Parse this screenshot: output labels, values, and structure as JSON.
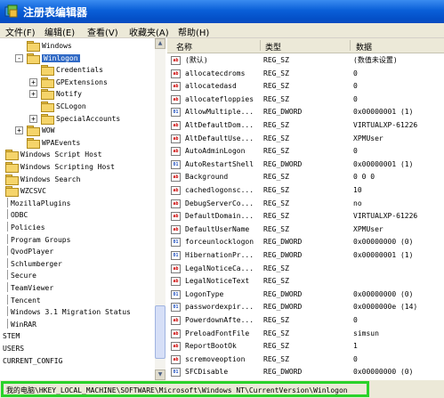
{
  "window": {
    "title": "注册表编辑器"
  },
  "menu": [
    "文件(F)",
    "编辑(E)",
    "查看(V)",
    "收藏夹(A)",
    "帮助(H)"
  ],
  "tree": [
    {
      "label": "Windows",
      "level": 3,
      "icon": "folder",
      "expander": ""
    },
    {
      "label": "Winlogon",
      "level": 3,
      "icon": "folder-open",
      "expander": "-",
      "selected": true
    },
    {
      "label": "Credentials",
      "level": 4,
      "icon": "folder",
      "expander": ""
    },
    {
      "label": "GPExtensions",
      "level": 4,
      "icon": "folder",
      "expander": "+"
    },
    {
      "label": "Notify",
      "level": 4,
      "icon": "folder",
      "expander": "+"
    },
    {
      "label": "SCLogon",
      "level": 4,
      "icon": "folder",
      "expander": ""
    },
    {
      "label": "SpecialAccounts",
      "level": 4,
      "icon": "folder",
      "expander": "+"
    },
    {
      "label": "WOW",
      "level": 3,
      "icon": "folder",
      "expander": "+"
    },
    {
      "label": "WPAEvents",
      "level": 3,
      "icon": "folder",
      "expander": ""
    },
    {
      "label": "Windows Script Host",
      "level": 1,
      "icon": "folder",
      "expander": ""
    },
    {
      "label": "Windows Scripting Host",
      "level": 1,
      "icon": "folder",
      "expander": ""
    },
    {
      "label": "Windows Search",
      "level": 1,
      "icon": "folder",
      "expander": ""
    },
    {
      "label": "WZCSVC",
      "level": 1,
      "icon": "folder",
      "expander": ""
    },
    {
      "label": "MozillaPlugins",
      "level": 0,
      "icon": "",
      "expander": ""
    },
    {
      "label": "ODBC",
      "level": 0,
      "icon": "",
      "expander": ""
    },
    {
      "label": "Policies",
      "level": 0,
      "icon": "",
      "expander": ""
    },
    {
      "label": "Program Groups",
      "level": 0,
      "icon": "",
      "expander": ""
    },
    {
      "label": "QvodPlayer",
      "level": 0,
      "icon": "",
      "expander": ""
    },
    {
      "label": "Schlumberger",
      "level": 0,
      "icon": "",
      "expander": ""
    },
    {
      "label": "Secure",
      "level": 0,
      "icon": "",
      "expander": ""
    },
    {
      "label": "TeamViewer",
      "level": 0,
      "icon": "",
      "expander": ""
    },
    {
      "label": "Tencent",
      "level": 0,
      "icon": "",
      "expander": ""
    },
    {
      "label": "Windows 3.1 Migration Status",
      "level": 0,
      "icon": "",
      "expander": ""
    },
    {
      "label": "WinRAR",
      "level": 0,
      "icon": "",
      "expander": ""
    },
    {
      "label": "STEM",
      "level": -1,
      "icon": "",
      "expander": ""
    },
    {
      "label": "USERS",
      "level": -1,
      "icon": "",
      "expander": ""
    },
    {
      "label": "CURRENT_CONFIG",
      "level": -1,
      "icon": "",
      "expander": ""
    }
  ],
  "columns": {
    "name": "名称",
    "type": "类型",
    "data": "数据"
  },
  "values": [
    {
      "icon": "string",
      "name": "(默认)",
      "type": "REG_SZ",
      "data": "(数值未设置)"
    },
    {
      "icon": "string",
      "name": "allocatecdroms",
      "type": "REG_SZ",
      "data": "0"
    },
    {
      "icon": "string",
      "name": "allocatedasd",
      "type": "REG_SZ",
      "data": "0"
    },
    {
      "icon": "string",
      "name": "allocatefloppies",
      "type": "REG_SZ",
      "data": "0"
    },
    {
      "icon": "binary",
      "name": "AllowMultiple...",
      "type": "REG_DWORD",
      "data": "0x00000001 (1)"
    },
    {
      "icon": "string",
      "name": "AltDefaultDom...",
      "type": "REG_SZ",
      "data": "VIRTUALXP-61226"
    },
    {
      "icon": "string",
      "name": "AltDefaultUse...",
      "type": "REG_SZ",
      "data": "XPMUser"
    },
    {
      "icon": "string",
      "name": "AutoAdminLogon",
      "type": "REG_SZ",
      "data": "0"
    },
    {
      "icon": "binary",
      "name": "AutoRestartShell",
      "type": "REG_DWORD",
      "data": "0x00000001 (1)"
    },
    {
      "icon": "string",
      "name": "Background",
      "type": "REG_SZ",
      "data": "0 0 0"
    },
    {
      "icon": "string",
      "name": "cachedlogonsc...",
      "type": "REG_SZ",
      "data": "10"
    },
    {
      "icon": "string",
      "name": "DebugServerCo...",
      "type": "REG_SZ",
      "data": "no"
    },
    {
      "icon": "string",
      "name": "DefaultDomain...",
      "type": "REG_SZ",
      "data": "VIRTUALXP-61226"
    },
    {
      "icon": "string",
      "name": "DefaultUserName",
      "type": "REG_SZ",
      "data": "XPMUser"
    },
    {
      "icon": "binary",
      "name": "forceunlocklogon",
      "type": "REG_DWORD",
      "data": "0x00000000 (0)"
    },
    {
      "icon": "binary",
      "name": "HibernationPr...",
      "type": "REG_DWORD",
      "data": "0x00000001 (1)"
    },
    {
      "icon": "string",
      "name": "LegalNoticeCa...",
      "type": "REG_SZ",
      "data": ""
    },
    {
      "icon": "string",
      "name": "LegalNoticeText",
      "type": "REG_SZ",
      "data": ""
    },
    {
      "icon": "binary",
      "name": "LogonType",
      "type": "REG_DWORD",
      "data": "0x00000000 (0)"
    },
    {
      "icon": "binary",
      "name": "passwordexpir...",
      "type": "REG_DWORD",
      "data": "0x0000000e (14)"
    },
    {
      "icon": "string",
      "name": "PowerdownAfte...",
      "type": "REG_SZ",
      "data": "0"
    },
    {
      "icon": "string",
      "name": "PreloadFontFile",
      "type": "REG_SZ",
      "data": "simsun"
    },
    {
      "icon": "string",
      "name": "ReportBootOk",
      "type": "REG_SZ",
      "data": "1"
    },
    {
      "icon": "string",
      "name": "scremoveoption",
      "type": "REG_SZ",
      "data": "0"
    },
    {
      "icon": "binary",
      "name": "SFCDisable",
      "type": "REG_DWORD",
      "data": "0x00000000 (0)"
    }
  ],
  "status": {
    "path": "我的电脑\\HKEY_LOCAL_MACHINE\\SOFTWARE\\Microsoft\\Windows NT\\CurrentVersion\\Winlogon"
  },
  "colors": {
    "titlebar": "#0a5fd8",
    "selection": "#316ac5",
    "highlight_box": "#2ad22a"
  }
}
